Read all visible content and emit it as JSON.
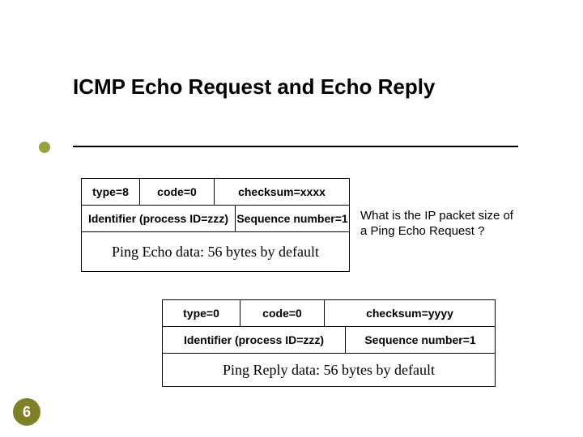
{
  "slide": {
    "title": "ICMP Echo Request and Echo Reply",
    "page_number": "6",
    "note": "What is the IP packet size of a Ping Echo Request ?"
  },
  "packet1": {
    "row1": {
      "type": "type=8",
      "code": "code=0",
      "checksum": "checksum=xxxx"
    },
    "row2": {
      "identifier": "Identifier (process ID=zzz)",
      "sequence": "Sequence number=1"
    },
    "data": "Ping Echo data:  56 bytes by default"
  },
  "packet2": {
    "row1": {
      "type": "type=0",
      "code": "code=0",
      "checksum": "checksum=yyyy"
    },
    "row2": {
      "identifier": "Identifier (process ID=zzz)",
      "sequence": "Sequence number=1"
    },
    "data": "Ping Reply data:  56 bytes by default"
  }
}
